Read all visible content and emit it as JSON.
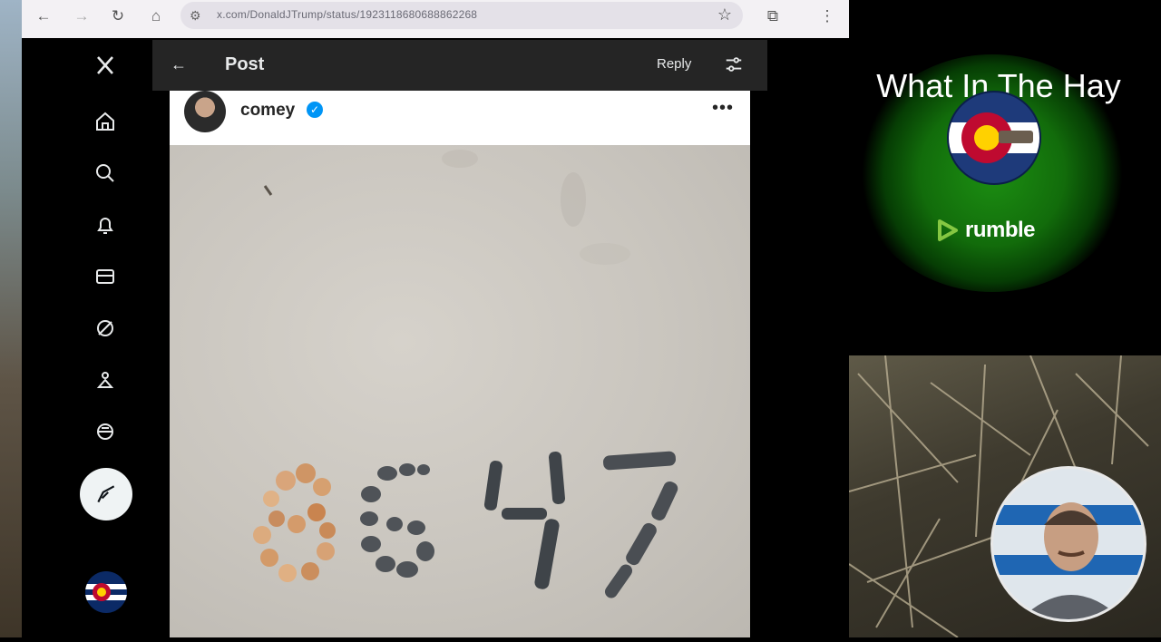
{
  "browser": {
    "url": "x.com/DonaldJTrump/status/1923118680688862268"
  },
  "post_header": {
    "title": "Post",
    "reply_label": "Reply"
  },
  "embedded_post": {
    "username": "comey",
    "verified": true,
    "more": "•••",
    "photo_text": "8647"
  },
  "overlay": {
    "channel_title": "What In The Hay",
    "platform": "rumble"
  },
  "sidebar_icons": [
    "x-logo-icon",
    "home-icon",
    "search-icon",
    "notifications-icon",
    "messages-icon",
    "grok-icon",
    "communities-icon",
    "premium-icon",
    "post-compose-icon"
  ],
  "colors": {
    "x_background": "#000000",
    "rumble_green": "#85c742",
    "verified_blue": "#0095f6"
  }
}
